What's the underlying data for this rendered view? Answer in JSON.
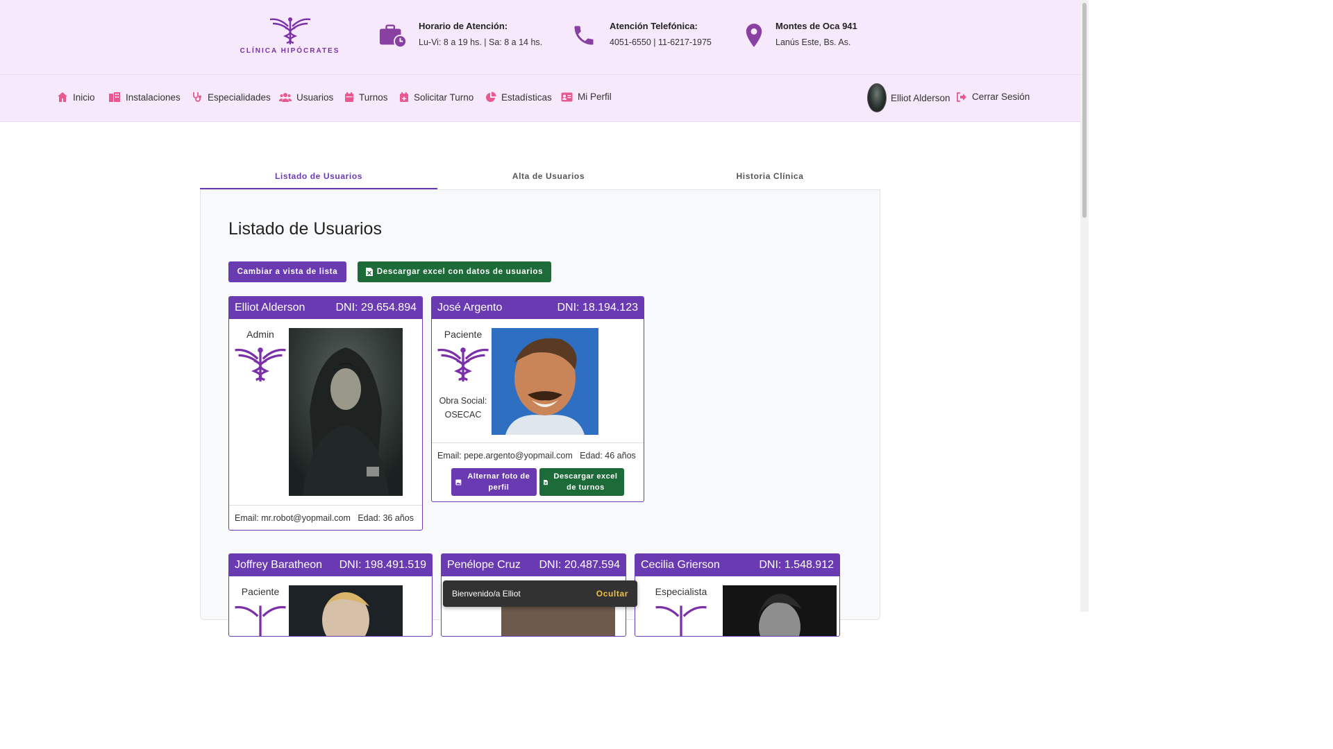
{
  "header": {
    "logo_text": "CLÍNICA HIPÓCRATES",
    "hours_title": "Horario de Atención:",
    "hours_value": "Lu-Vi: 8 a 19 hs. | Sa: 8 a 14 hs.",
    "phone_title": "Atención Telefónica:",
    "phone_value": "4051-6550 | 11-6217-1975",
    "address_title": "Montes de Oca 941",
    "address_value": "Lanús Este, Bs. As."
  },
  "nav": {
    "items": [
      {
        "label": "Inicio",
        "icon": "home-icon"
      },
      {
        "label": "Instalaciones",
        "icon": "building-icon"
      },
      {
        "label": "Especialidades",
        "icon": "stethoscope-icon"
      },
      {
        "label": "Usuarios",
        "icon": "users-icon"
      },
      {
        "label": "Turnos",
        "icon": "calendar-icon"
      },
      {
        "label": "Solicitar Turno",
        "icon": "calendar-plus-icon"
      },
      {
        "label": "Estadísticas",
        "icon": "pie-chart-icon"
      },
      {
        "label": "Mi Perfil",
        "icon": "id-card-icon"
      }
    ],
    "user_name": "Elliot Alderson",
    "logout_label": "Cerrar Sesión"
  },
  "tabs": [
    {
      "label": "Listado de Usuarios",
      "active": true
    },
    {
      "label": "Alta de Usuarios",
      "active": false
    },
    {
      "label": "Historia Clínica",
      "active": false
    }
  ],
  "main": {
    "title": "Listado de Usuarios",
    "toggle_view_label": "Cambiar a vista de lista",
    "download_excel_label": "Descargar excel con datos de usuarios"
  },
  "cards": [
    {
      "name": "Elliot Alderson",
      "dni": "DNI: 29.654.894",
      "role": "Admin",
      "email": "Email: mr.robot@yopmail.com",
      "age": "Edad: 36 años"
    },
    {
      "name": "José Argento",
      "dni": "DNI: 18.194.123",
      "role": "Paciente",
      "obra_label": "Obra Social:",
      "obra_value": "OSECAC",
      "email": "Email: pepe.argento@yopmail.com",
      "age": "Edad: 46 años",
      "btn_photo": "Alternar foto de perfil",
      "btn_excel": "Descargar excel de turnos"
    },
    {
      "name": "Joffrey Baratheon",
      "dni": "DNI: 198.491.519",
      "role": "Paciente"
    },
    {
      "name": "Penélope Cruz",
      "dni": "DNI: 20.487.594",
      "role": ""
    },
    {
      "name": "Cecilia Grierson",
      "dni": "DNI: 1.548.912",
      "role": "Especialista"
    }
  ],
  "toast": {
    "message": "Bienvenido/a Elliot",
    "action": "Ocultar"
  },
  "colors": {
    "brand_purple": "#6a3ab2",
    "header_bg": "#f6e9fb",
    "nav_icon_pink": "#e85a8f",
    "success_green": "#1e6b3a"
  }
}
